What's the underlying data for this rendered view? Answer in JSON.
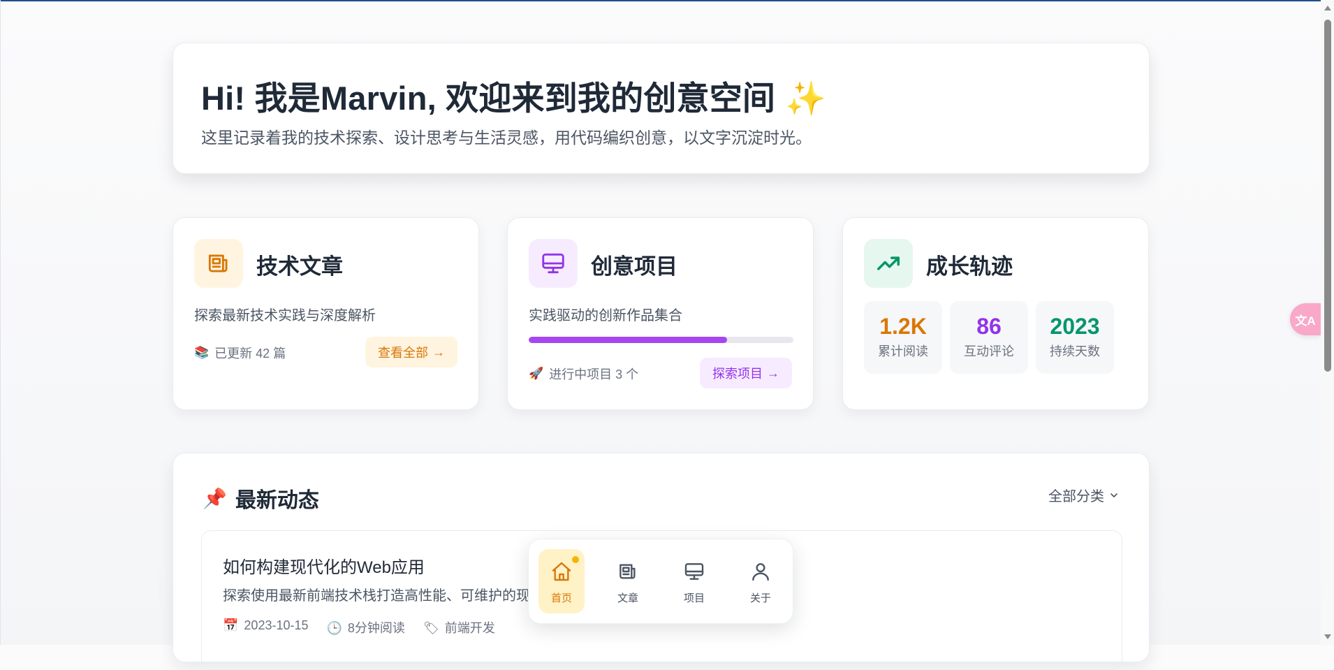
{
  "hero": {
    "title": "Hi! 我是Marvin, 欢迎来到我的创意空间",
    "title_emoji": "✨",
    "subtitle": "这里记录着我的技术探索、设计思考与生活灵感，用代码编织创意，以文字沉淀时光。"
  },
  "cards": {
    "articles": {
      "icon": "newspaper-icon",
      "title": "技术文章",
      "description": "探索最新技术实践与深度解析",
      "meta_icon": "books-icon",
      "meta": "已更新 42 篇",
      "button": "查看全部",
      "accent": "#d97706"
    },
    "projects": {
      "icon": "monitor-icon",
      "title": "创意项目",
      "description": "实践驱动的创新作品集合",
      "progress": 0.75,
      "meta_icon": "rocket-icon",
      "meta": "进行中项目 3 个",
      "button": "探索项目",
      "accent": "#9333ea"
    },
    "growth": {
      "icon": "trending-up-icon",
      "title": "成长轨迹",
      "stats": [
        {
          "value": "1.2K",
          "label": "累计阅读",
          "color": "#d97706"
        },
        {
          "value": "86",
          "label": "互动评论",
          "color": "#9333ea"
        },
        {
          "value": "2023",
          "label": "持续天数",
          "color": "#059669"
        }
      ]
    }
  },
  "latest": {
    "icon": "pushpin-icon",
    "title": "最新动态",
    "filter": "全部分类",
    "articles": [
      {
        "title": "如何构建现代化的Web应用",
        "excerpt": "探索使用最新前端技术栈打造高性能、可维护的现",
        "date": "2023-10-15",
        "read_time": "8分钟阅读",
        "tag": "前端开发"
      }
    ]
  },
  "bottom_nav": {
    "items": [
      {
        "label": "首页",
        "icon": "home-icon",
        "active": true
      },
      {
        "label": "文章",
        "icon": "newspaper-icon",
        "active": false
      },
      {
        "label": "项目",
        "icon": "monitor-icon",
        "active": false
      },
      {
        "label": "关于",
        "icon": "user-icon",
        "active": false
      }
    ]
  },
  "translate_button": {
    "icon": "translate-icon"
  }
}
